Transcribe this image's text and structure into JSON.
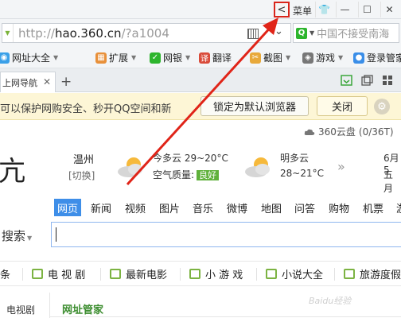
{
  "titlebar": {
    "collapse_glyph": "<",
    "menu_label": "菜单",
    "win_buttons": [
      "👕",
      "—",
      "☐",
      "✕"
    ]
  },
  "addressbar": {
    "url_prefix": "http://",
    "url_host": "hao.360.cn",
    "url_path": "/?a1004",
    "search_placeholder": "中国不接受南海"
  },
  "bookmarks": [
    {
      "label": "网址大全",
      "color": "#3aa0e8",
      "dropdown": true
    },
    {
      "label": "扩展",
      "color": "#e8903a",
      "dropdown": true
    },
    {
      "label": "网银",
      "color": "#2db52d",
      "dropdown": true
    },
    {
      "label": "翻译",
      "color": "#d94b3a",
      "dropdown": false
    },
    {
      "label": "截图",
      "color": "#e8a93a",
      "dropdown": true
    },
    {
      "label": "游戏",
      "color": "#777777",
      "dropdown": true
    },
    {
      "label": "登录管家",
      "color": "#3a8ee8",
      "dropdown": false
    }
  ],
  "tabbar": {
    "active_tab": "上网导航",
    "close_glyph": "✕",
    "new_tab_glyph": "+"
  },
  "banner": {
    "text": "可以保护网购安全、秒开QQ空间和新",
    "lock_button": "锁定为默认浏览器",
    "close_button": "关闭",
    "gear_glyph": "⚙"
  },
  "cloud": {
    "label": "360云盘",
    "usage": "(0/36T)"
  },
  "logo_fragment": "亢",
  "weather": {
    "city": "温州",
    "switch": "[切换]",
    "today_desc": "今多云",
    "today_temp": "29~20°C",
    "aq_label": "空气质量:",
    "aq_value": "良好",
    "tomorrow_desc": "明多云",
    "tomorrow_temp": "28~21°C",
    "more_glyph": "»",
    "date_fragment": "6月5",
    "week_fragment": "五月"
  },
  "search_categories": [
    "网页",
    "新闻",
    "视频",
    "图片",
    "音乐",
    "微博",
    "地图",
    "问答",
    "购物",
    "机票",
    "游"
  ],
  "search": {
    "label": "搜索",
    "dropdown_glyph": "▼"
  },
  "quick_links": [
    "条",
    "电 视 剧",
    "最新电影",
    "小 游 戏",
    "小说大全",
    "旅游度假"
  ],
  "bottom": {
    "left_label": "电视剧",
    "title": "网址管家"
  },
  "watermark": "Baidu经验"
}
